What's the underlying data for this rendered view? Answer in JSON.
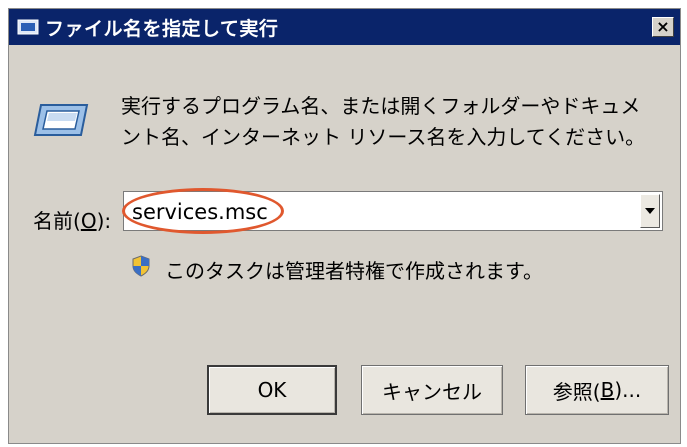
{
  "window": {
    "title": "ファイル名を指定して実行",
    "close_label": "×"
  },
  "description": {
    "line1": "実行するプログラム名、または開くフォルダーやドキュメ",
    "line2": "ント名、インターネット リソース名を入力してください。"
  },
  "name_field": {
    "label_prefix": "名前(",
    "label_accel": "O",
    "label_suffix": "):",
    "value": "services.msc"
  },
  "admin_notice": "このタスクは管理者特権で作成されます。",
  "buttons": {
    "ok": "OK",
    "cancel": "キャンセル",
    "browse_prefix": "参照(",
    "browse_accel": "B",
    "browse_suffix": ")..."
  },
  "colors": {
    "titlebar": "#0a246a",
    "dialog_bg": "#d6d2ca",
    "highlight_oval": "#e0582e"
  }
}
